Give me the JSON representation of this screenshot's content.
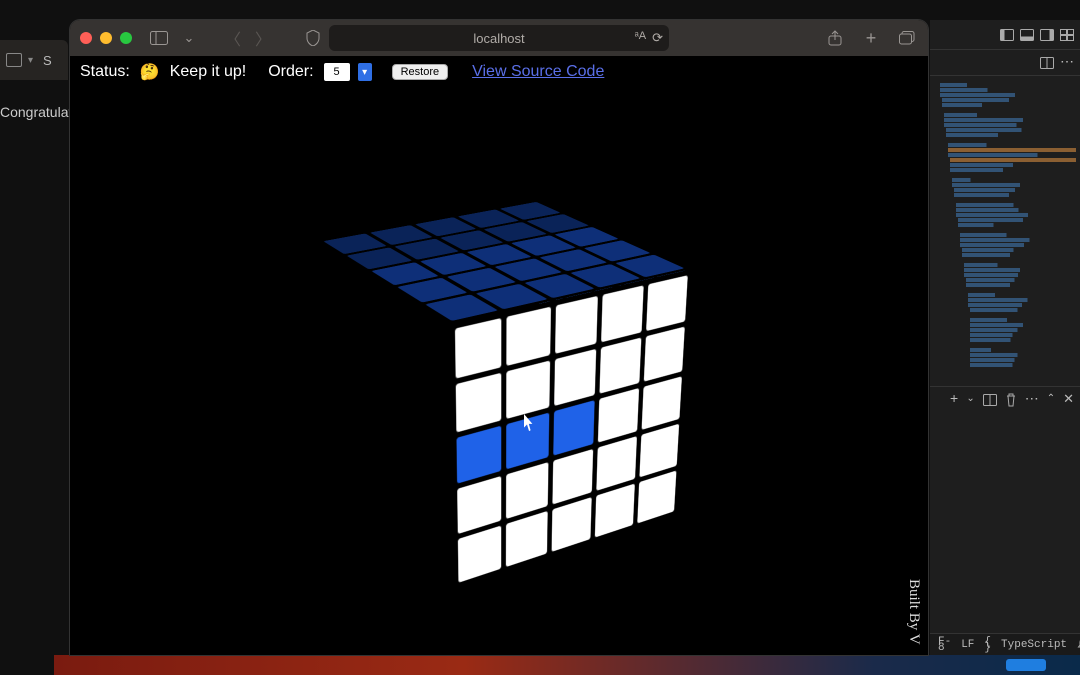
{
  "background": {
    "truncated_text": "Congratulatio"
  },
  "left_window": {
    "label": "S"
  },
  "safari": {
    "address": "localhost",
    "page": {
      "status_label": "Status:",
      "status_emoji": "🤔",
      "status_msg": "Keep it up!",
      "order_label": "Order:",
      "order_value": "5",
      "restore": "Restore",
      "source_link": "View Source Code",
      "built_by": "Built By V"
    },
    "cube": {
      "order": 5,
      "colors": {
        "white": "#ffffff",
        "blue": "#1f62e8",
        "blue_light": "#3d7bf0",
        "navy": "#0e2f78",
        "navy_dark": "#0a2358"
      },
      "front_rows": [
        [
          "white",
          "white",
          "white",
          "white",
          "white"
        ],
        [
          "white",
          "white",
          "white",
          "white",
          "white"
        ],
        [
          "blue",
          "blue",
          "blue",
          "white",
          "white"
        ],
        [
          "white",
          "white",
          "white",
          "white",
          "white"
        ],
        [
          "white",
          "white",
          "white",
          "white",
          "white"
        ]
      ],
      "right_rows": [
        [
          "blue",
          "blue",
          "blue",
          "blue",
          "blue"
        ],
        [
          "blue",
          "blue",
          "blue",
          "blue",
          "blue"
        ],
        [
          "blue_light",
          "blue_light",
          "blue_light",
          "blue_light",
          "blue_light"
        ],
        [
          "blue",
          "blue",
          "blue",
          "blue",
          "blue"
        ],
        [
          "blue",
          "blue",
          "blue",
          "blue",
          "blue"
        ]
      ],
      "top_rows": [
        [
          "navy_dark",
          "navy_dark",
          "navy_dark",
          "navy_dark",
          "navy_dark"
        ],
        [
          "navy_dark",
          "navy_dark",
          "navy_dark",
          "navy_dark",
          "navy_dark"
        ],
        [
          "navy",
          "navy",
          "navy",
          "navy",
          "navy"
        ],
        [
          "navy",
          "navy",
          "navy",
          "navy",
          "navy"
        ],
        [
          "navy",
          "navy",
          "navy",
          "navy",
          "navy"
        ]
      ]
    }
  },
  "editor": {
    "status": {
      "enc": "F-8",
      "eol": "LF",
      "lang_prefix": "{ }",
      "lang": "TypeScript"
    }
  }
}
